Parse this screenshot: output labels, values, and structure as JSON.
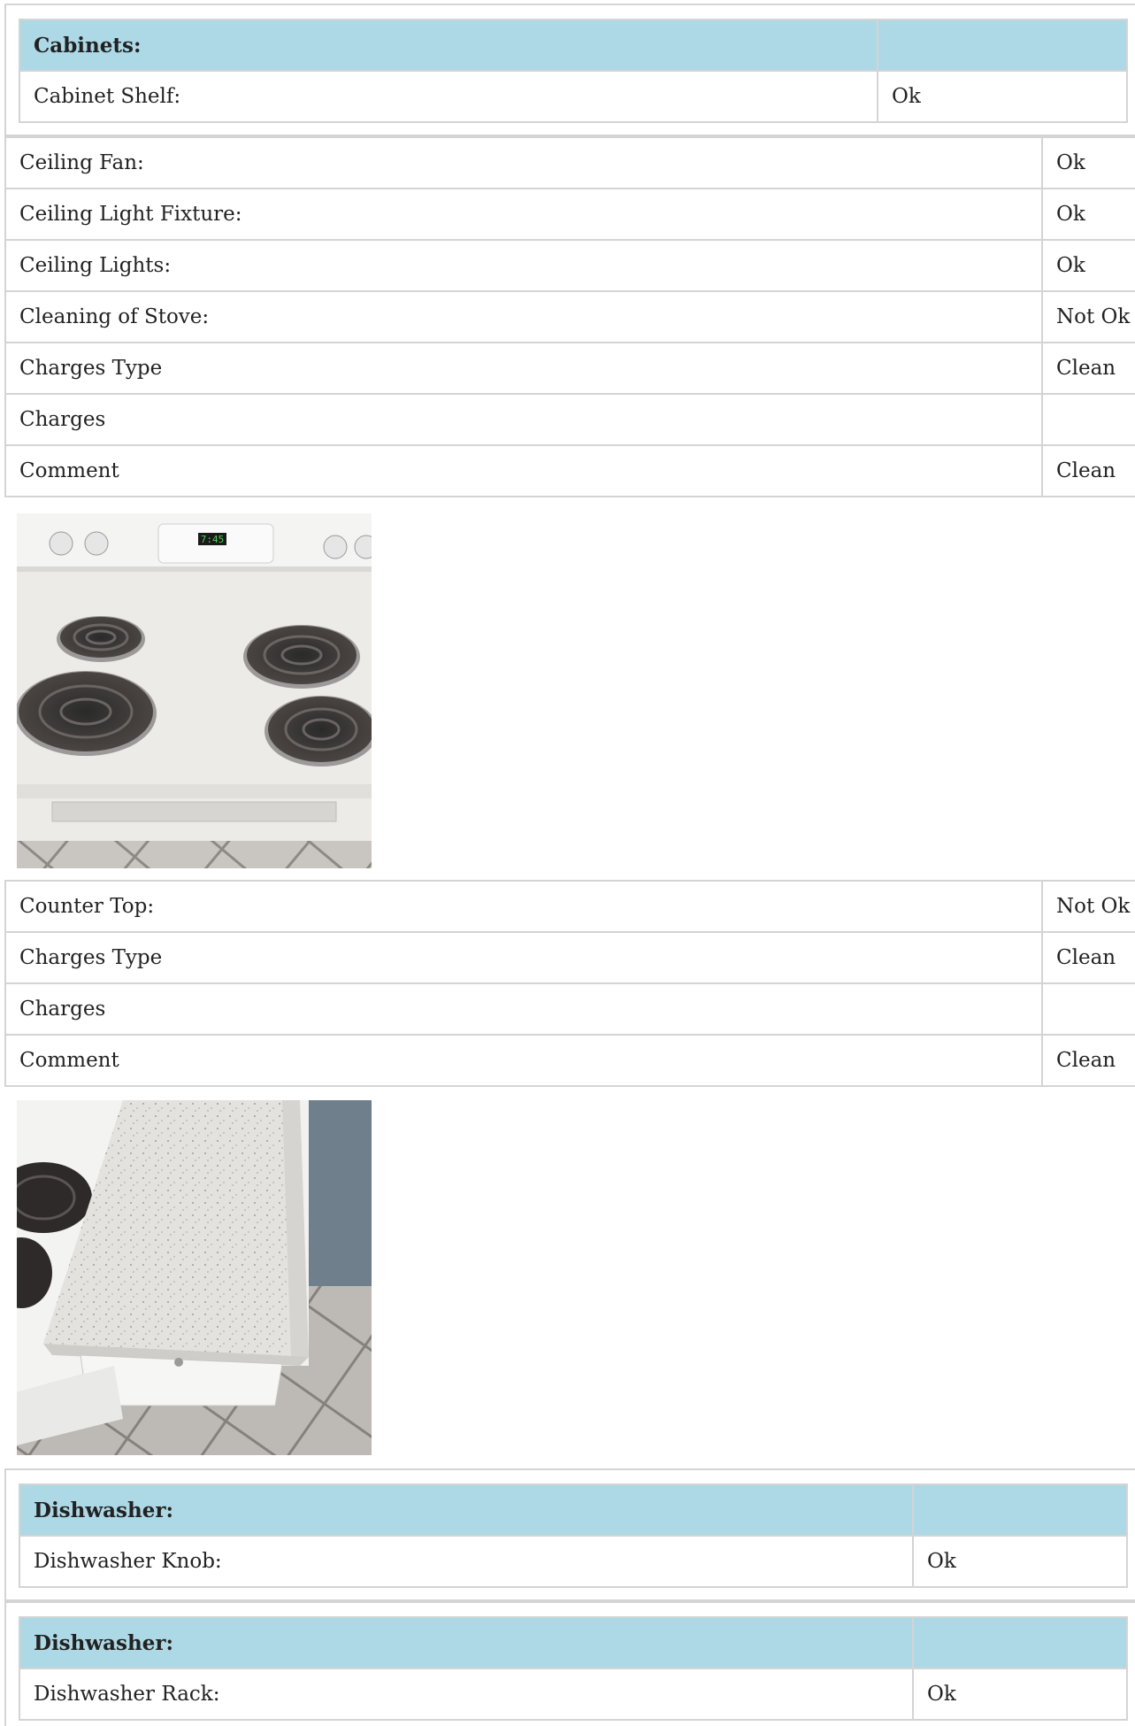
{
  "cabinets": {
    "heading": "Cabinets:",
    "rows": [
      {
        "label": "Cabinet Shelf:",
        "value": "Ok"
      }
    ]
  },
  "group1": [
    {
      "label": "Ceiling Fan:",
      "value": "Ok"
    },
    {
      "label": "Ceiling Light Fixture:",
      "value": "Ok"
    },
    {
      "label": "Ceiling Lights:",
      "value": "Ok"
    },
    {
      "label": "Cleaning of Stove:",
      "value": "Not Ok"
    },
    {
      "label": "Charges Type",
      "value": "Clean"
    },
    {
      "label": "Charges",
      "value": ""
    },
    {
      "label": "Comment",
      "value": "Clean"
    }
  ],
  "photo1": {
    "subject": "electric-stove-photo",
    "display": "7:45"
  },
  "group2": [
    {
      "label": "Counter Top:",
      "value": "Not Ok"
    },
    {
      "label": "Charges Type",
      "value": "Clean"
    },
    {
      "label": "Charges",
      "value": ""
    },
    {
      "label": "Comment",
      "value": "Clean"
    }
  ],
  "photo2": {
    "subject": "counter-top-photo"
  },
  "dishwasher1": {
    "heading": "Dishwasher:",
    "rows": [
      {
        "label": "Dishwasher Knob:",
        "value": "Ok"
      }
    ]
  },
  "dishwasher2": {
    "heading": "Dishwasher:",
    "rows": [
      {
        "label": "Dishwasher Rack:",
        "value": "Ok"
      }
    ]
  },
  "colors": {
    "header_bg": "#add8e6",
    "border": "#d4d4d4"
  }
}
